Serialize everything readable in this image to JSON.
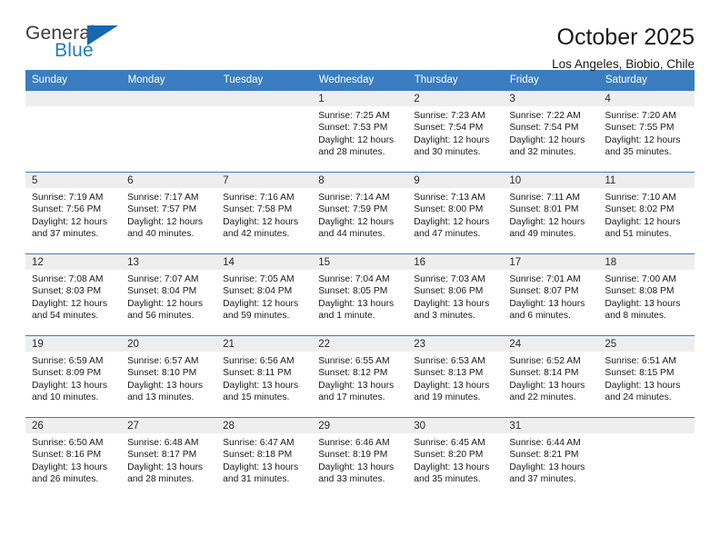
{
  "brand": {
    "name_part1": "General",
    "name_part2": "Blue",
    "triangle_icon": "triangle-icon",
    "accent_color": "#1668b0"
  },
  "header": {
    "title": "October 2025",
    "location": "Los Angeles, Biobio, Chile"
  },
  "theme": {
    "header_bg": "#3a7dc0",
    "daynum_bg": "#eeeeee",
    "cell_bg": "#ffffff",
    "text": "#1a1a1a"
  },
  "weekdays": [
    "Sunday",
    "Monday",
    "Tuesday",
    "Wednesday",
    "Thursday",
    "Friday",
    "Saturday"
  ],
  "weeks": [
    [
      {
        "day": "",
        "sunrise": "",
        "sunset": "",
        "daylight1": "",
        "daylight2": ""
      },
      {
        "day": "",
        "sunrise": "",
        "sunset": "",
        "daylight1": "",
        "daylight2": ""
      },
      {
        "day": "",
        "sunrise": "",
        "sunset": "",
        "daylight1": "",
        "daylight2": ""
      },
      {
        "day": "1",
        "sunrise": "Sunrise: 7:25 AM",
        "sunset": "Sunset: 7:53 PM",
        "daylight1": "Daylight: 12 hours",
        "daylight2": "and 28 minutes."
      },
      {
        "day": "2",
        "sunrise": "Sunrise: 7:23 AM",
        "sunset": "Sunset: 7:54 PM",
        "daylight1": "Daylight: 12 hours",
        "daylight2": "and 30 minutes."
      },
      {
        "day": "3",
        "sunrise": "Sunrise: 7:22 AM",
        "sunset": "Sunset: 7:54 PM",
        "daylight1": "Daylight: 12 hours",
        "daylight2": "and 32 minutes."
      },
      {
        "day": "4",
        "sunrise": "Sunrise: 7:20 AM",
        "sunset": "Sunset: 7:55 PM",
        "daylight1": "Daylight: 12 hours",
        "daylight2": "and 35 minutes."
      }
    ],
    [
      {
        "day": "5",
        "sunrise": "Sunrise: 7:19 AM",
        "sunset": "Sunset: 7:56 PM",
        "daylight1": "Daylight: 12 hours",
        "daylight2": "and 37 minutes."
      },
      {
        "day": "6",
        "sunrise": "Sunrise: 7:17 AM",
        "sunset": "Sunset: 7:57 PM",
        "daylight1": "Daylight: 12 hours",
        "daylight2": "and 40 minutes."
      },
      {
        "day": "7",
        "sunrise": "Sunrise: 7:16 AM",
        "sunset": "Sunset: 7:58 PM",
        "daylight1": "Daylight: 12 hours",
        "daylight2": "and 42 minutes."
      },
      {
        "day": "8",
        "sunrise": "Sunrise: 7:14 AM",
        "sunset": "Sunset: 7:59 PM",
        "daylight1": "Daylight: 12 hours",
        "daylight2": "and 44 minutes."
      },
      {
        "day": "9",
        "sunrise": "Sunrise: 7:13 AM",
        "sunset": "Sunset: 8:00 PM",
        "daylight1": "Daylight: 12 hours",
        "daylight2": "and 47 minutes."
      },
      {
        "day": "10",
        "sunrise": "Sunrise: 7:11 AM",
        "sunset": "Sunset: 8:01 PM",
        "daylight1": "Daylight: 12 hours",
        "daylight2": "and 49 minutes."
      },
      {
        "day": "11",
        "sunrise": "Sunrise: 7:10 AM",
        "sunset": "Sunset: 8:02 PM",
        "daylight1": "Daylight: 12 hours",
        "daylight2": "and 51 minutes."
      }
    ],
    [
      {
        "day": "12",
        "sunrise": "Sunrise: 7:08 AM",
        "sunset": "Sunset: 8:03 PM",
        "daylight1": "Daylight: 12 hours",
        "daylight2": "and 54 minutes."
      },
      {
        "day": "13",
        "sunrise": "Sunrise: 7:07 AM",
        "sunset": "Sunset: 8:04 PM",
        "daylight1": "Daylight: 12 hours",
        "daylight2": "and 56 minutes."
      },
      {
        "day": "14",
        "sunrise": "Sunrise: 7:05 AM",
        "sunset": "Sunset: 8:04 PM",
        "daylight1": "Daylight: 12 hours",
        "daylight2": "and 59 minutes."
      },
      {
        "day": "15",
        "sunrise": "Sunrise: 7:04 AM",
        "sunset": "Sunset: 8:05 PM",
        "daylight1": "Daylight: 13 hours",
        "daylight2": "and 1 minute."
      },
      {
        "day": "16",
        "sunrise": "Sunrise: 7:03 AM",
        "sunset": "Sunset: 8:06 PM",
        "daylight1": "Daylight: 13 hours",
        "daylight2": "and 3 minutes."
      },
      {
        "day": "17",
        "sunrise": "Sunrise: 7:01 AM",
        "sunset": "Sunset: 8:07 PM",
        "daylight1": "Daylight: 13 hours",
        "daylight2": "and 6 minutes."
      },
      {
        "day": "18",
        "sunrise": "Sunrise: 7:00 AM",
        "sunset": "Sunset: 8:08 PM",
        "daylight1": "Daylight: 13 hours",
        "daylight2": "and 8 minutes."
      }
    ],
    [
      {
        "day": "19",
        "sunrise": "Sunrise: 6:59 AM",
        "sunset": "Sunset: 8:09 PM",
        "daylight1": "Daylight: 13 hours",
        "daylight2": "and 10 minutes."
      },
      {
        "day": "20",
        "sunrise": "Sunrise: 6:57 AM",
        "sunset": "Sunset: 8:10 PM",
        "daylight1": "Daylight: 13 hours",
        "daylight2": "and 13 minutes."
      },
      {
        "day": "21",
        "sunrise": "Sunrise: 6:56 AM",
        "sunset": "Sunset: 8:11 PM",
        "daylight1": "Daylight: 13 hours",
        "daylight2": "and 15 minutes."
      },
      {
        "day": "22",
        "sunrise": "Sunrise: 6:55 AM",
        "sunset": "Sunset: 8:12 PM",
        "daylight1": "Daylight: 13 hours",
        "daylight2": "and 17 minutes."
      },
      {
        "day": "23",
        "sunrise": "Sunrise: 6:53 AM",
        "sunset": "Sunset: 8:13 PM",
        "daylight1": "Daylight: 13 hours",
        "daylight2": "and 19 minutes."
      },
      {
        "day": "24",
        "sunrise": "Sunrise: 6:52 AM",
        "sunset": "Sunset: 8:14 PM",
        "daylight1": "Daylight: 13 hours",
        "daylight2": "and 22 minutes."
      },
      {
        "day": "25",
        "sunrise": "Sunrise: 6:51 AM",
        "sunset": "Sunset: 8:15 PM",
        "daylight1": "Daylight: 13 hours",
        "daylight2": "and 24 minutes."
      }
    ],
    [
      {
        "day": "26",
        "sunrise": "Sunrise: 6:50 AM",
        "sunset": "Sunset: 8:16 PM",
        "daylight1": "Daylight: 13 hours",
        "daylight2": "and 26 minutes."
      },
      {
        "day": "27",
        "sunrise": "Sunrise: 6:48 AM",
        "sunset": "Sunset: 8:17 PM",
        "daylight1": "Daylight: 13 hours",
        "daylight2": "and 28 minutes."
      },
      {
        "day": "28",
        "sunrise": "Sunrise: 6:47 AM",
        "sunset": "Sunset: 8:18 PM",
        "daylight1": "Daylight: 13 hours",
        "daylight2": "and 31 minutes."
      },
      {
        "day": "29",
        "sunrise": "Sunrise: 6:46 AM",
        "sunset": "Sunset: 8:19 PM",
        "daylight1": "Daylight: 13 hours",
        "daylight2": "and 33 minutes."
      },
      {
        "day": "30",
        "sunrise": "Sunrise: 6:45 AM",
        "sunset": "Sunset: 8:20 PM",
        "daylight1": "Daylight: 13 hours",
        "daylight2": "and 35 minutes."
      },
      {
        "day": "31",
        "sunrise": "Sunrise: 6:44 AM",
        "sunset": "Sunset: 8:21 PM",
        "daylight1": "Daylight: 13 hours",
        "daylight2": "and 37 minutes."
      },
      {
        "day": "",
        "sunrise": "",
        "sunset": "",
        "daylight1": "",
        "daylight2": ""
      }
    ]
  ]
}
